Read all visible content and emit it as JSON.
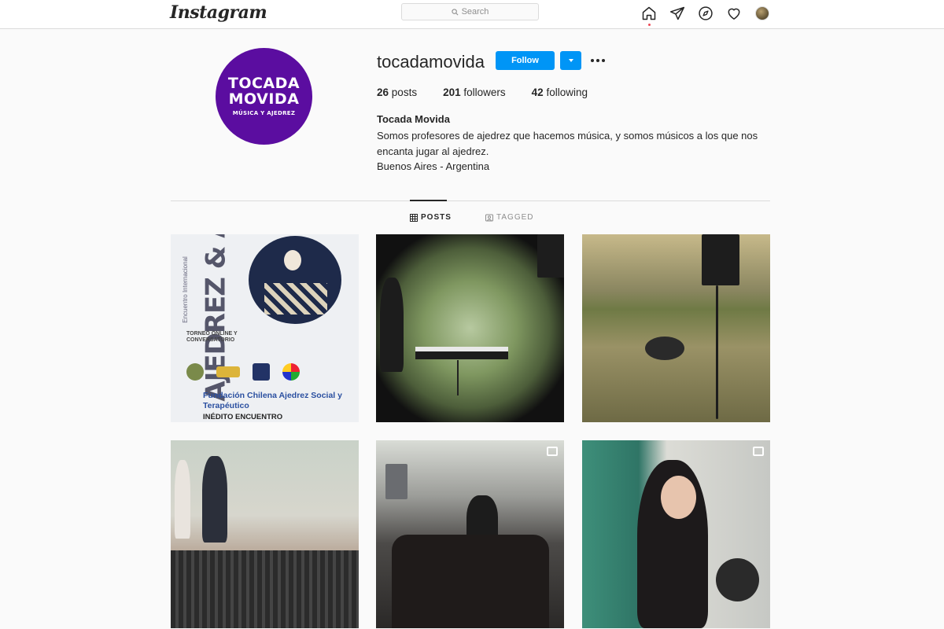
{
  "nav": {
    "logo": "Instagram",
    "search_placeholder": "Search"
  },
  "profile": {
    "avatar_line1": "TOCADA",
    "avatar_line2": "MOVIDA",
    "avatar_line3": "MÚSICA Y AJEDREZ",
    "username": "tocadamovida",
    "follow_label": "Follow",
    "posts_count": "26",
    "posts_label": "posts",
    "followers_count": "201",
    "followers_label": "followers",
    "following_count": "42",
    "following_label": "following",
    "full_name": "Tocada Movida",
    "bio_line1": "Somos profesores de ajedrez que hacemos música, y somos músicos a los que nos",
    "bio_line2": "encanta jugar al ajedrez.",
    "bio_line3": "Buenos Aires - Argentina"
  },
  "tabs": {
    "posts": "POSTS",
    "tagged": "TAGGED"
  },
  "posts": {
    "p1": {
      "title_main": "AJEDREZ & ARTE",
      "title_small": "Encuentro Internacional",
      "subtitle": "TORNEO ONLINE Y CONVERSATORIO",
      "foundation": "Fundación Chilena Ajedrez Social y Terapéutico",
      "footer": "INÉDITO ENCUENTRO"
    }
  },
  "colors": {
    "accent": "#0095f6",
    "avatar_bg": "#5b0da0",
    "notification_dot": "#ed4956"
  },
  "icons": [
    "search-icon",
    "home-icon",
    "direct-icon",
    "explore-icon",
    "heart-icon",
    "grid-icon",
    "tag-icon",
    "video-icon"
  ]
}
